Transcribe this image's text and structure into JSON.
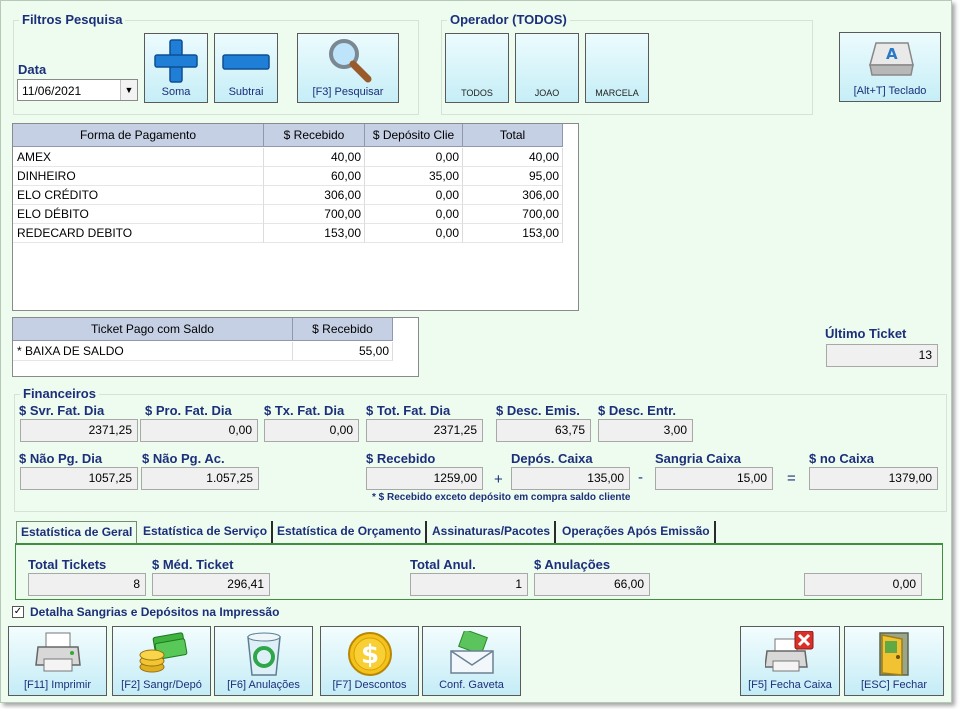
{
  "filtros": {
    "title": "Filtros Pesquisa",
    "data_label": "Data",
    "date_value": "11/06/2021",
    "soma_label": "Soma",
    "subtrai_label": "Subtrai",
    "pesquisar_label": "[F3] Pesquisar"
  },
  "operador": {
    "title": "Operador (TODOS)",
    "tiles": [
      "TODOS",
      "JOAO",
      "MARCELA"
    ]
  },
  "teclado_label": "[Alt+T] Teclado",
  "payments": {
    "columns": [
      "Forma de Pagamento",
      "$ Recebido",
      "$ Depósito Clie",
      "Total"
    ],
    "rows": [
      [
        "AMEX",
        "40,00",
        "0,00",
        "40,00"
      ],
      [
        "DINHEIRO",
        "60,00",
        "35,00",
        "95,00"
      ],
      [
        "ELO CRÉDITO",
        "306,00",
        "0,00",
        "306,00"
      ],
      [
        "ELO DÉBITO",
        "700,00",
        "0,00",
        "700,00"
      ],
      [
        "REDECARD DEBITO",
        "153,00",
        "0,00",
        "153,00"
      ]
    ]
  },
  "ticket_saldo": {
    "columns": [
      "Ticket Pago com Saldo",
      "$ Recebido"
    ],
    "rows": [
      [
        "* BAIXA DE SALDO",
        "55,00"
      ]
    ]
  },
  "ultimo_ticket": {
    "label": "Último Ticket",
    "value": "13"
  },
  "financeiros": {
    "title": "Financeiros",
    "svr_fat_dia": {
      "label": "$ Svr. Fat. Dia",
      "value": "2371,25"
    },
    "pro_fat_dia": {
      "label": "$ Pro. Fat. Dia",
      "value": "0,00"
    },
    "tx_fat_dia": {
      "label": "$ Tx. Fat. Dia",
      "value": "0,00"
    },
    "tot_fat_dia": {
      "label": "$ Tot. Fat. Dia",
      "value": "2371,25"
    },
    "desc_emis": {
      "label": "$ Desc. Emis.",
      "value": "63,75"
    },
    "desc_entr": {
      "label": "$ Desc.  Entr.",
      "value": "3,00"
    },
    "nao_pg_dia": {
      "label": "$ Não Pg. Dia",
      "value": "1057,25"
    },
    "nao_pg_ac": {
      "label": "$ Não Pg. Ac.",
      "value": "1.057,25"
    },
    "recebido": {
      "label": "$ Recebido",
      "value": "1259,00"
    },
    "depos_caixa": {
      "label": "Depós. Caixa",
      "value": "135,00"
    },
    "sangria_caixa": {
      "label": "Sangria Caixa",
      "value": "15,00"
    },
    "no_caixa": {
      "label": "$ no Caixa",
      "value": "1379,00"
    },
    "op_plus": "+",
    "op_minus": "-",
    "op_equals": "=",
    "note": "* $ Recebido exceto depósito em compra saldo cliente"
  },
  "tabs": [
    "Estatística de Geral",
    "Estatística de Serviço",
    "Estatística de Orçamento",
    "Assinaturas/Pacotes",
    "Operações Após Emissão"
  ],
  "stats": {
    "total_tickets": {
      "label": "Total Tickets",
      "value": "8"
    },
    "med_ticket": {
      "label": "$ Méd. Ticket",
      "value": "296,41"
    },
    "total_anul": {
      "label": "Total Anul.",
      "value": "1"
    },
    "anulacoes": {
      "label": "$ Anulações",
      "value": "66,00"
    },
    "extra_value": "0,00"
  },
  "detalha_checkbox": {
    "label": "Detalha Sangrias e Depósitos na Impressão",
    "checked": true
  },
  "buttons": {
    "imprimir": "[F11] Imprimir",
    "sangr_depo": "[F2] Sangr/Depó",
    "anulacoes": "[F6] Anulações",
    "descontos": "[F7] Descontos",
    "gaveta": "Conf. Gaveta",
    "fecha_caixa": "[F5] Fecha Caixa",
    "fechar": "[ESC] Fechar"
  },
  "colors": {
    "background": "#eefbef",
    "label_blue": "#1b2f7a",
    "header_blue": "#c5d0e4",
    "plus_blue": "#1f7fd6"
  }
}
